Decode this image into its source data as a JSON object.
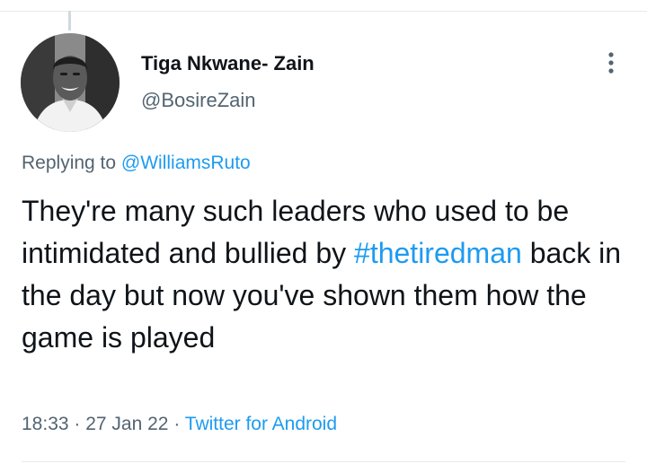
{
  "tweet": {
    "author": {
      "name": "Tiga Nkwane- Zain",
      "handle": "@BosireZain"
    },
    "replying_prefix": "Replying to ",
    "replying_to": "@WilliamsRuto",
    "text_before_hashtag": "They're many such leaders who used to be intimidated and bullied by ",
    "hashtag": "#thetiredman",
    "text_after_hashtag": " back in the day but now you've shown them how the game is played",
    "time": "18:33",
    "separator": " · ",
    "date": "27 Jan 22",
    "source": "Twitter for Android"
  },
  "icons": {
    "more": "more-vertical-icon",
    "avatar": "profile-photo"
  },
  "colors": {
    "text": "#0f1419",
    "secondary": "#536471",
    "link": "#1d9bf0"
  }
}
